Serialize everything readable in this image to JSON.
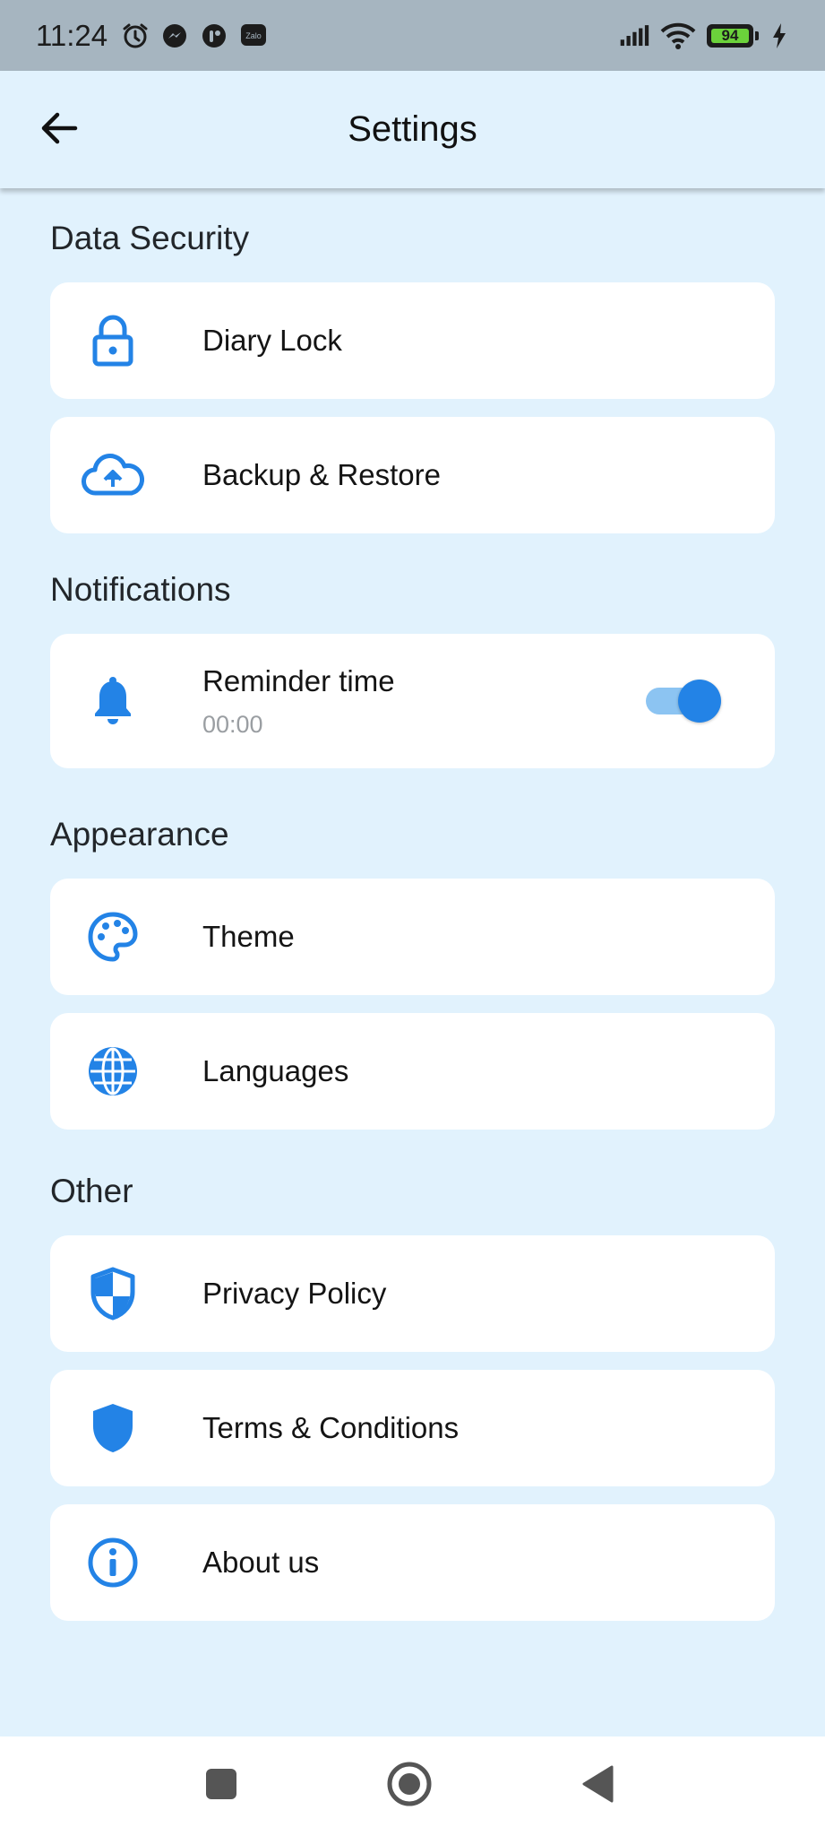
{
  "status_bar": {
    "time": "11:24",
    "battery_level": "94",
    "notification_icons": [
      "alarm-icon",
      "messenger-icon",
      "app-icon",
      "zalo-icon"
    ],
    "zalo_label": "Zalo"
  },
  "header": {
    "title": "Settings",
    "back_icon": "arrow-left-icon"
  },
  "sections": {
    "data_security": {
      "title": "Data Security",
      "items": [
        {
          "label": "Diary Lock",
          "icon": "lock-icon"
        },
        {
          "label": "Backup & Restore",
          "icon": "cloud-upload-icon"
        }
      ]
    },
    "notifications": {
      "title": "Notifications",
      "items": [
        {
          "label": "Reminder time",
          "value": "00:00",
          "icon": "bell-icon",
          "toggle_on": true
        }
      ]
    },
    "appearance": {
      "title": "Appearance",
      "items": [
        {
          "label": "Theme",
          "icon": "palette-icon"
        },
        {
          "label": "Languages",
          "icon": "globe-icon"
        }
      ]
    },
    "other": {
      "title": "Other",
      "items": [
        {
          "label": "Privacy Policy",
          "icon": "shield-half-icon"
        },
        {
          "label": "Terms & Conditions",
          "icon": "shield-icon"
        },
        {
          "label": "About us",
          "icon": "info-icon"
        }
      ]
    }
  },
  "nav_bar": {
    "buttons": [
      "recents-icon",
      "home-icon",
      "back-triangle-icon"
    ]
  },
  "colors": {
    "background": "#e1f2fd",
    "accent": "#2383e6",
    "card": "#ffffff",
    "status_bar": "#a6b5c0"
  }
}
